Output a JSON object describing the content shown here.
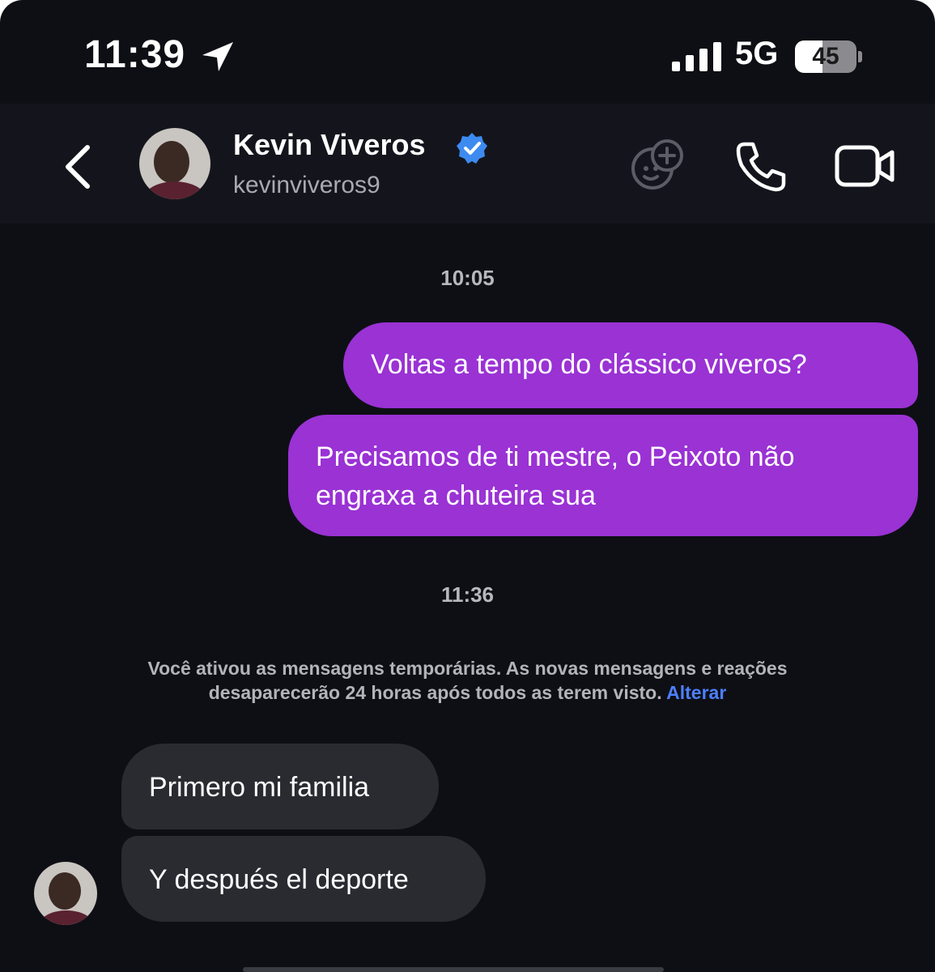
{
  "status_bar": {
    "time": "11:39",
    "network": "5G",
    "battery_level": "45",
    "battery_fraction": 0.45
  },
  "header": {
    "back_icon": "chevron-left-icon",
    "contact_name": "Kevin Viveros",
    "verified_icon": "verified-badge-icon",
    "username": "kevinviveros9",
    "actions": [
      "effects-icon",
      "phone-icon",
      "video-camera-icon"
    ]
  },
  "messages": {
    "timestamp_1": "10:05",
    "sent_1": "Voltas a tempo do clássico viveros?",
    "sent_2": "Precisamos de ti mestre, o Peixoto não engraxa a chuteira sua",
    "timestamp_2": "11:36",
    "system_notice": "Você ativou as mensagens temporárias. As novas mensagens e reações desaparecerão 24 horas após todos as terem visto.",
    "system_link": "Alterar",
    "received_1": "Primero mi familia",
    "received_2": "Y después el deporte"
  },
  "colors": {
    "background": "#0e0f15",
    "header": "#14151c",
    "sent_bubble": "#9a32d4",
    "received_bubble": "#2a2b31",
    "link": "#4d7fff",
    "verified": "#3d8bf0"
  }
}
